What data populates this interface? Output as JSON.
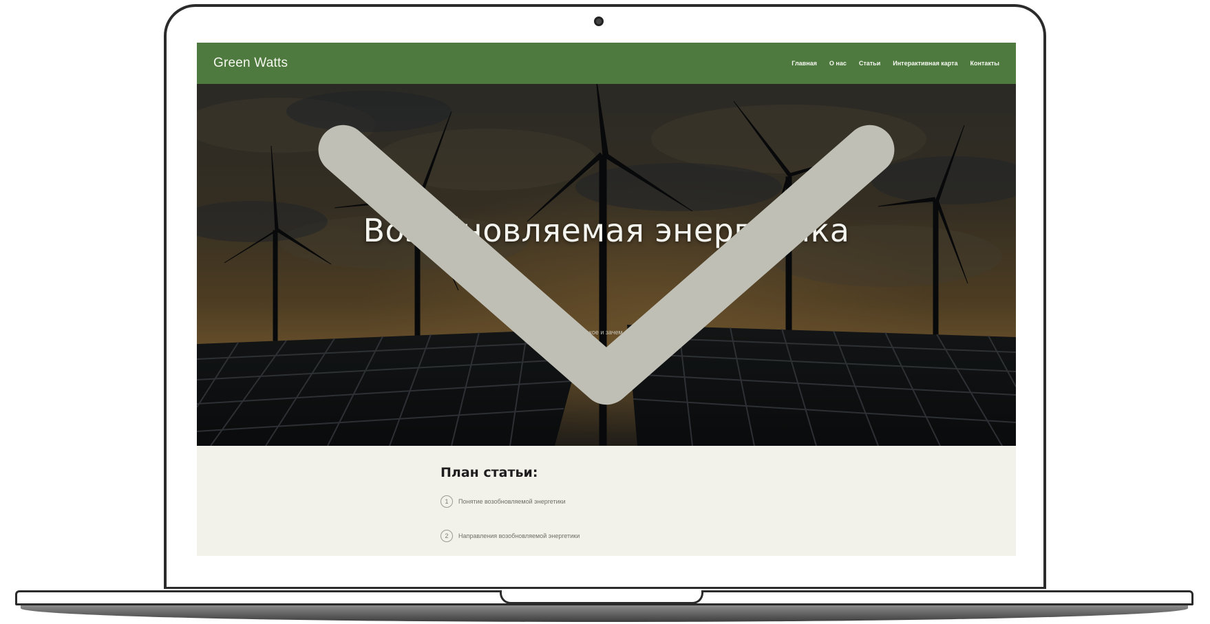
{
  "site": {
    "brand": "Green Watts",
    "nav": [
      {
        "label": "Главная"
      },
      {
        "label": "О нас"
      },
      {
        "label": "Статьи"
      },
      {
        "label": "Интерактивная карта"
      },
      {
        "label": "Контакты"
      }
    ]
  },
  "hero": {
    "title": "Возобновляемая энергетика",
    "subtitle": "Что это такое и зачем это нужно",
    "scroll_icon": "chevron-down-icon"
  },
  "plan": {
    "title": "План статьи:",
    "items": [
      {
        "number": "1",
        "label": "Понятие возобновляемой энергетики"
      },
      {
        "number": "2",
        "label": "Направления возобновляемой энергетики"
      }
    ]
  },
  "colors": {
    "navbar": "#4f7a3f",
    "content_bg": "#f2f1ea",
    "hero_overlay": "#2a2a22"
  }
}
